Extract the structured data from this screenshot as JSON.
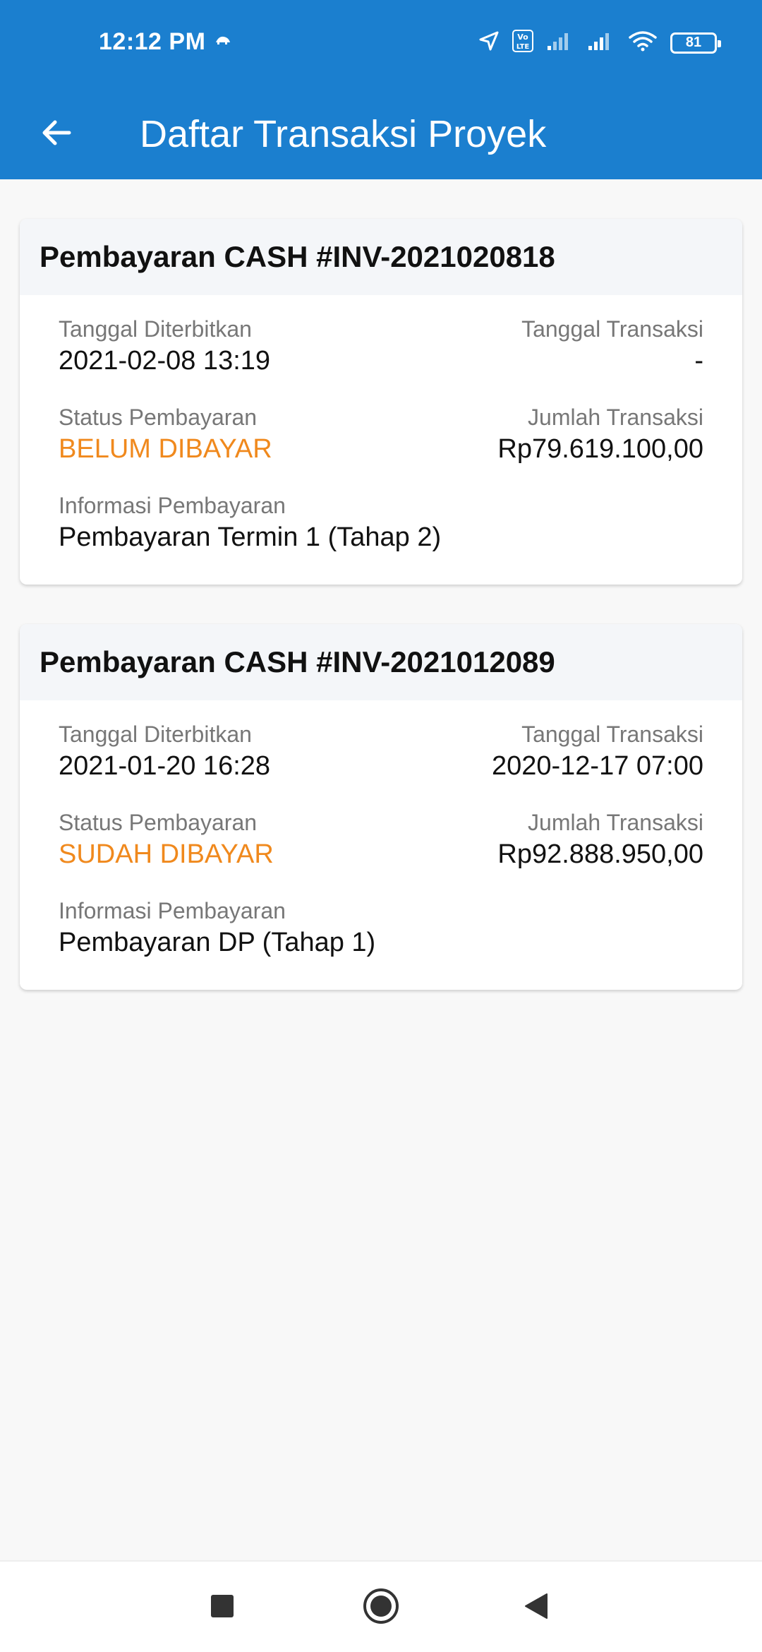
{
  "status_bar": {
    "time": "12:12 PM",
    "battery": "81"
  },
  "app_bar": {
    "title": "Daftar Transaksi Proyek"
  },
  "transactions": [
    {
      "title": "Pembayaran CASH #INV-2021020818",
      "issued_label": "Tanggal Diterbitkan",
      "issued_value": "2021-02-08 13:19",
      "transaction_date_label": "Tanggal Transaksi",
      "transaction_date_value": "-",
      "status_label": "Status Pembayaran",
      "status_value": "BELUM DIBAYAR",
      "amount_label": "Jumlah Transaksi",
      "amount_value": "Rp79.619.100,00",
      "info_label": "Informasi Pembayaran",
      "info_value": "Pembayaran Termin 1 (Tahap 2)"
    },
    {
      "title": "Pembayaran CASH #INV-2021012089",
      "issued_label": "Tanggal Diterbitkan",
      "issued_value": "2021-01-20 16:28",
      "transaction_date_label": "Tanggal Transaksi",
      "transaction_date_value": "2020-12-17 07:00",
      "status_label": "Status Pembayaran",
      "status_value": "SUDAH DIBAYAR",
      "amount_label": "Jumlah Transaksi",
      "amount_value": "Rp92.888.950,00",
      "info_label": "Informasi Pembayaran",
      "info_value": "Pembayaran DP (Tahap 1)"
    }
  ],
  "colors": {
    "primary": "#1b7fcf",
    "status_text": "#f0891d",
    "background": "#f8f8f8"
  },
  "icons": {
    "back": "arrow-left-icon",
    "nav_recents": "square-icon",
    "nav_home": "circle-icon",
    "nav_back": "triangle-back-icon"
  }
}
